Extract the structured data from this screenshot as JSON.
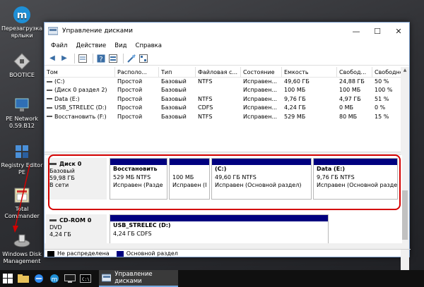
{
  "desktop": {
    "icons": [
      {
        "label": "Перезагрузка ярлыки",
        "icon": "reload-shortcuts-icon"
      },
      {
        "label": "BOOTICE",
        "icon": "bootice-icon"
      },
      {
        "label": "PE Network 0.59.B12",
        "icon": "pe-network-icon"
      },
      {
        "label": "Registry Editor PE",
        "icon": "registry-editor-icon"
      },
      {
        "label": "Total Commander",
        "icon": "total-commander-icon"
      },
      {
        "label": "Windows Disk Management",
        "icon": "disk-management-icon"
      }
    ]
  },
  "window": {
    "title": "Управление дисками",
    "controls": {
      "minimize": "—",
      "maximize": "☐",
      "close": "✕"
    },
    "menu": [
      "Файл",
      "Действие",
      "Вид",
      "Справка"
    ],
    "columns": [
      "Том",
      "Располо...",
      "Тип",
      "Файловая с...",
      "Состояние",
      "Емкость",
      "Свобод...",
      "Свободно %"
    ],
    "volumes": [
      [
        "(C:)",
        "Простой",
        "Базовый",
        "NTFS",
        "Исправен...",
        "49,60 ГБ",
        "24,88 ГБ",
        "50 %"
      ],
      [
        "(Диск 0 раздел 2)",
        "Простой",
        "Базовый",
        "",
        "Исправен...",
        "100 МБ",
        "100 МБ",
        "100 %"
      ],
      [
        "Data (E:)",
        "Простой",
        "Базовый",
        "NTFS",
        "Исправен...",
        "9,76 ГБ",
        "4,97 ГБ",
        "51 %"
      ],
      [
        "USB_STRELEC (D:)",
        "Простой",
        "Базовый",
        "CDFS",
        "Исправен...",
        "4,24 ГБ",
        "0 МБ",
        "0 %"
      ],
      [
        "Восстановить (F:)",
        "Простой",
        "Базовый",
        "NTFS",
        "Исправен...",
        "529 МБ",
        "80 МБ",
        "15 %"
      ]
    ],
    "disks": [
      {
        "name": "Диск 0",
        "type": "Базовый",
        "size": "59,98 ГБ",
        "status": "В сети",
        "partitions": [
          {
            "name": "Восстановить",
            "size": "529 МБ NTFS",
            "status": "Исправен (Разде"
          },
          {
            "name": "",
            "size": "100 МБ",
            "status": "Исправен (I"
          },
          {
            "name": "(C:)",
            "size": "49,60 ГБ NTFS",
            "status": "Исправен (Основной раздел)"
          },
          {
            "name": "Data  (E:)",
            "size": "9,76 ГБ NTFS",
            "status": "Исправен (Основной раздел)"
          }
        ]
      },
      {
        "name": "CD-ROM 0",
        "type": "DVD",
        "size": "4,24 ГБ",
        "status": "",
        "partitions": [
          {
            "name": "USB_STRELEC  (D:)",
            "size": "4,24 ГБ CDFS",
            "status": ""
          }
        ]
      }
    ],
    "legend": [
      {
        "label": "Не распределена",
        "color": "#000000"
      },
      {
        "label": "Основной раздел",
        "color": "#00007f"
      }
    ]
  },
  "taskbar": {
    "active_task": "Управление дисками"
  },
  "colors": {
    "highlight": "#d40000",
    "partition_bar": "#00007f"
  }
}
